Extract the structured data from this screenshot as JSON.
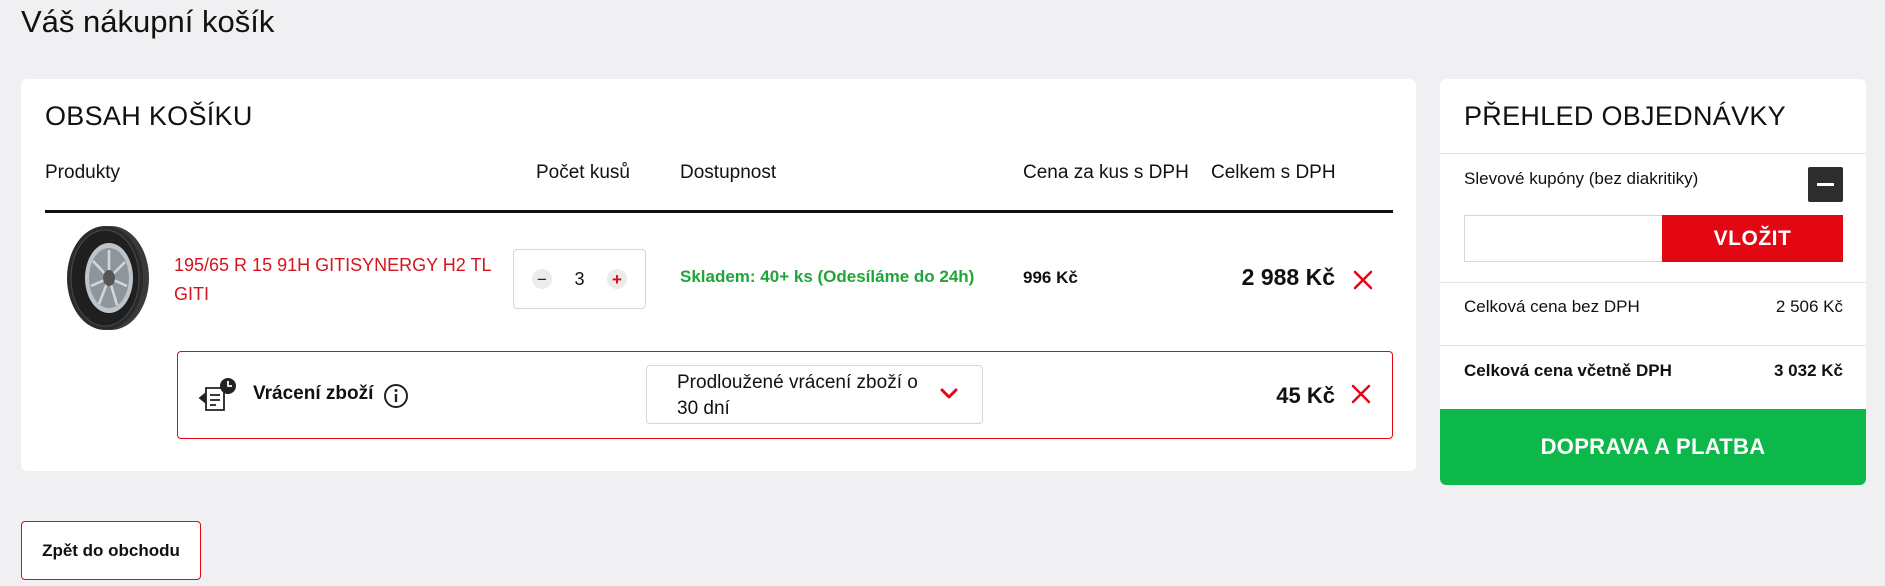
{
  "page": {
    "title": "Váš nákupní košík"
  },
  "cart": {
    "heading": "OBSAH KOŠÍKU",
    "columns": {
      "products": "Produkty",
      "quantity": "Počet kusů",
      "availability": "Dostupnost",
      "unit_price": "Cena za kus s DPH",
      "total": "Celkem s DPH"
    },
    "items": [
      {
        "name": "195/65 R 15 91H GITISYNERGY H2 TL GITI",
        "quantity": "3",
        "availability": "Skladem: 40+ ks (Odesíláme do 24h)",
        "unit_price": "996 Kč",
        "total": "2 988 Kč"
      }
    ],
    "return_service": {
      "label": "Vrácení zboží",
      "selected_option": "Prodloužené vrácení zboží o 30 dní",
      "price": "45 Kč"
    }
  },
  "summary": {
    "heading": "PŘEHLED OBJEDNÁVKY",
    "coupon_label": "Slevové kupóny (bez diakritiky)",
    "coupon_value": "",
    "insert_label": "VLOŽIT",
    "price_without_vat_label": "Celková cena bez DPH",
    "price_without_vat": "2 506 Kč",
    "price_with_vat_label": "Celková cena včetně DPH",
    "price_with_vat": "3 032 Kč",
    "checkout_label": "DOPRAVA A PLATBA"
  },
  "back_label": "Zpět do obchodu",
  "colors": {
    "accent_red": "#e30613",
    "stock_green": "#1fa538",
    "checkout_green": "#0db84a",
    "background": "#f0f0f3"
  },
  "icons": {
    "remove": "close-icon",
    "return": "return-clock-icon",
    "info": "info-icon",
    "dropdown": "chevron-down-icon",
    "collapse": "minus-icon"
  }
}
